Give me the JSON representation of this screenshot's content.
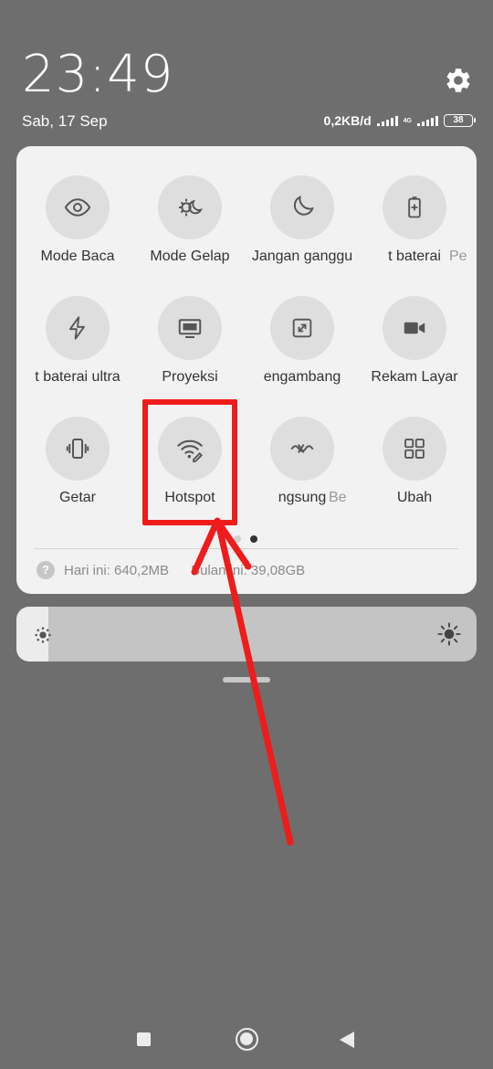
{
  "status_bar": {
    "time": "23:49",
    "date": "Sab, 17 Sep",
    "network_speed": "0,2KB/d",
    "network_type": "4G",
    "battery_level": "38",
    "settings_icon": "gear-icon"
  },
  "tiles": [
    {
      "label": "Mode Baca",
      "icon": "eye-icon"
    },
    {
      "label": "Mode Gelap",
      "icon": "dark-mode-icon"
    },
    {
      "label": "Jangan ganggu",
      "icon": "moon-icon"
    },
    {
      "label": "t baterai",
      "icon": "battery-saver-icon"
    },
    {
      "label": "Pe",
      "icon": "partial-icon"
    },
    {
      "label": "t baterai ultra",
      "icon": "lightning-icon"
    },
    {
      "label": "Proyeksi",
      "icon": "monitor-icon"
    },
    {
      "label": "engambang",
      "icon": "floating-window-icon"
    },
    {
      "label": "Rekam Layar",
      "icon": "video-camera-icon"
    },
    {
      "label": "Getar",
      "icon": "vibrate-icon"
    },
    {
      "label": "Hotspot",
      "icon": "hotspot-icon"
    },
    {
      "label": "ngsung",
      "icon": "nearby-share-icon"
    },
    {
      "label": "Be",
      "icon": "partial-icon"
    },
    {
      "label": "Ubah",
      "icon": "edit-grid-icon"
    }
  ],
  "pagination": {
    "pages": 2,
    "current": 2
  },
  "data_usage": {
    "help": "?",
    "today": "Hari ini: 640,2MB",
    "month": "Bulan ini: 39,08GB"
  },
  "brightness": {
    "level": 0.07
  },
  "colors": {
    "background": "#6e6e6e",
    "panel": "#f2f2f2",
    "tile_circle": "#dedede",
    "annotation_red": "#ee1c1c"
  }
}
